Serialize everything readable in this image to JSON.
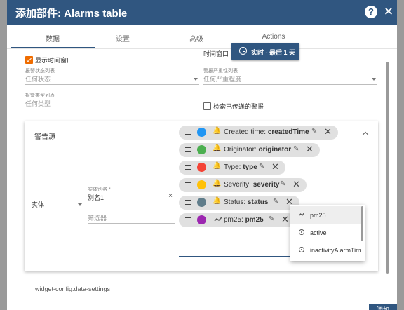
{
  "header": {
    "title": "添加部件: Alarms table",
    "help": "?",
    "close": "✕"
  },
  "tabs": [
    "数据",
    "设置",
    "高级",
    "Actions"
  ],
  "form": {
    "show_time_window": "显示时间窗口",
    "time_window_label": "时间窗口",
    "time_window_button": "实时 - 最后 1 天",
    "status_list_label": "报警状态列表",
    "status_list_placeholder": "任何状态",
    "severity_list_label": "警报严重性列表",
    "severity_list_placeholder": "任何严重程度",
    "type_list_label": "报警类型列表",
    "type_list_placeholder": "任何类型",
    "search_propagated": "检索已传递的警报"
  },
  "alarm_source": {
    "title": "警告源",
    "entity_type": "实体",
    "alias_label": "实体别名 *",
    "alias_value": "别名1",
    "alias_clear": "×",
    "filter_placeholder": "筛选器"
  },
  "chips": [
    {
      "label": "Created time:",
      "key": "createdTime",
      "color": "#2196f3",
      "icon": "bell-icon"
    },
    {
      "label": "Originator:",
      "key": "originator",
      "color": "#4caf50",
      "icon": "bell-icon"
    },
    {
      "label": "Type:",
      "key": "type",
      "color": "#f44336",
      "icon": "bell-icon"
    },
    {
      "label": "Severity:",
      "key": "severity",
      "color": "#ffc107",
      "icon": "bell-icon"
    },
    {
      "label": "Status:",
      "key": "status",
      "color": "#607d8b",
      "icon": "bell-icon"
    },
    {
      "label": "pm25:",
      "key": "pm25",
      "color": "#9c27b0",
      "icon": "timeseries-icon"
    }
  ],
  "dropdown": [
    {
      "label": "pm25",
      "icon": "timeseries-icon"
    },
    {
      "label": "active",
      "icon": "attribute-icon"
    },
    {
      "label": "inactivityAlarmTim",
      "icon": "attribute-icon"
    }
  ],
  "footer": {
    "settings_text": "widget-config.data-settings",
    "add_button": "添加"
  }
}
